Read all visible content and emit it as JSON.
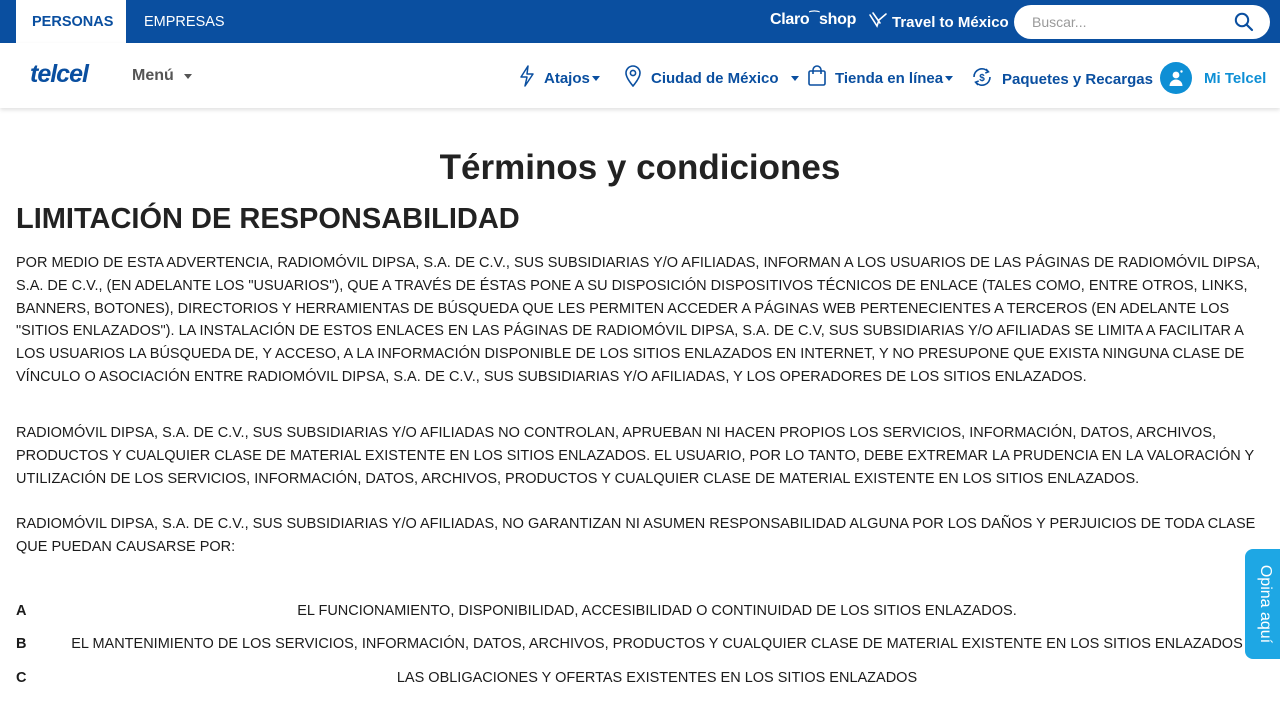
{
  "topbar": {
    "personas": "PERSONAS",
    "empresas": "EMPRESAS",
    "claroshop_claro": "Claro",
    "claroshop_shop": "shop",
    "travel": "Travel to México",
    "search_placeholder": "Buscar..."
  },
  "nav": {
    "logo": "telcel",
    "menu": "Menú",
    "atajos": "Atajos",
    "ciudad": "Ciudad de México",
    "tienda": "Tienda en línea",
    "paquetes": "Paquetes y Recargas",
    "mitelcel": "Mi Telcel"
  },
  "colors": {
    "brand_blue": "#0a4fa0",
    "accent_cyan": "#0e8fd5",
    "opina_tab": "#1ea7e4"
  },
  "content": {
    "page_title": "Términos y condiciones",
    "section_title": "LIMITACIÓN DE RESPONSABILIDAD",
    "p1": "POR MEDIO DE ESTA ADVERTENCIA, RADIOMÓVIL DIPSA, S.A. DE C.V., SUS SUBSIDIARIAS Y/O AFILIADAS, INFORMAN A LOS USUARIOS DE LAS PÁGINAS DE RADIOMÓVIL DIPSA, S.A. DE C.V., (EN ADELANTE LOS \"USUARIOS\"), QUE A TRAVÉS DE ÉSTAS PONE A SU DISPOSICIÓN DISPOSITIVOS TÉCNICOS DE ENLACE (TALES COMO, ENTRE OTROS, LINKS, BANNERS, BOTONES), DIRECTORIOS Y HERRAMIENTAS DE BÚSQUEDA QUE LES PERMITEN ACCEDER A PÁGINAS WEB PERTENECIENTES A TERCEROS (EN ADELANTE LOS \"SITIOS ENLAZADOS\"). LA INSTALACIÓN DE ESTOS ENLACES EN LAS PÁGINAS DE RADIOMÓVIL DIPSA, S.A. DE C.V, SUS SUBSIDIARIAS Y/O AFILIADAS SE LIMITA A FACILITAR A LOS USUARIOS LA BÚSQUEDA DE, Y ACCESO, A LA INFORMACIÓN DISPONIBLE DE LOS SITIOS ENLAZADOS EN INTERNET, Y NO PRESUPONE QUE EXISTA NINGUNA CLASE DE VÍNCULO O ASOCIACIÓN ENTRE RADIOMÓVIL DIPSA, S.A. DE C.V., SUS SUBSIDIARIAS Y/O AFILIADAS, Y LOS OPERADORES DE LOS SITIOS ENLAZADOS.",
    "p2": "RADIOMÓVIL DIPSA, S.A. DE C.V., SUS SUBSIDIARIAS Y/O AFILIADAS NO CONTROLAN, APRUEBAN NI HACEN PROPIOS LOS SERVICIOS, INFORMACIÓN, DATOS, ARCHIVOS, PRODUCTOS Y CUALQUIER CLASE DE MATERIAL EXISTENTE EN LOS SITIOS ENLAZADOS. EL USUARIO, POR LO TANTO, DEBE EXTREMAR LA PRUDENCIA EN LA VALORACIÓN Y UTILIZACIÓN DE LOS SERVICIOS, INFORMACIÓN, DATOS, ARCHIVOS, PRODUCTOS Y CUALQUIER CLASE DE MATERIAL EXISTENTE EN LOS SITIOS ENLAZADOS.",
    "p3": "RADIOMÓVIL DIPSA, S.A. DE C.V., SUS SUBSIDIARIAS Y/O AFILIADAS, NO GARANTIZAN NI ASUMEN RESPONSABILIDAD ALGUNA POR LOS DAÑOS Y PERJUICIOS DE TODA CLASE QUE PUEDAN CAUSARSE POR:",
    "items": [
      {
        "letter": "A",
        "text": "EL FUNCIONAMIENTO, DISPONIBILIDAD, ACCESIBILIDAD O CONTINUIDAD DE LOS SITIOS ENLAZADOS."
      },
      {
        "letter": "B",
        "text": "EL MANTENIMIENTO DE LOS SERVICIOS, INFORMACIÓN, DATOS, ARCHIVOS, PRODUCTOS Y CUALQUIER CLASE DE MATERIAL EXISTENTE EN LOS SITIOS ENLAZADOS"
      },
      {
        "letter": "C",
        "text": "LAS OBLIGACIONES Y OFERTAS EXISTENTES EN LOS SITIOS ENLAZADOS"
      }
    ]
  },
  "feedback": {
    "label": "Opina aquí"
  }
}
